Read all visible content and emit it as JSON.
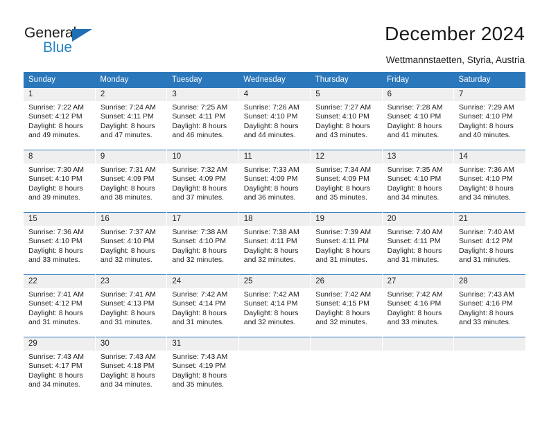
{
  "logo": {
    "text_primary": "General",
    "text_secondary": "Blue",
    "triangle_icon": "triangle-icon",
    "color_primary": "#1a1a1a",
    "color_secondary": "#2484c6"
  },
  "header": {
    "title": "December 2024",
    "subtitle": "Wettmannstaetten, Styria, Austria"
  },
  "theme": {
    "header_bg": "#2b77bb",
    "daynum_bg": "#efefef",
    "text": "#222222"
  },
  "calendar": {
    "weekday_headers": [
      "Sunday",
      "Monday",
      "Tuesday",
      "Wednesday",
      "Thursday",
      "Friday",
      "Saturday"
    ],
    "weeks": [
      [
        {
          "day": "1",
          "sunrise": "Sunrise: 7:22 AM",
          "sunset": "Sunset: 4:12 PM",
          "daylight_line1": "Daylight: 8 hours",
          "daylight_line2": "and 49 minutes."
        },
        {
          "day": "2",
          "sunrise": "Sunrise: 7:24 AM",
          "sunset": "Sunset: 4:11 PM",
          "daylight_line1": "Daylight: 8 hours",
          "daylight_line2": "and 47 minutes."
        },
        {
          "day": "3",
          "sunrise": "Sunrise: 7:25 AM",
          "sunset": "Sunset: 4:11 PM",
          "daylight_line1": "Daylight: 8 hours",
          "daylight_line2": "and 46 minutes."
        },
        {
          "day": "4",
          "sunrise": "Sunrise: 7:26 AM",
          "sunset": "Sunset: 4:10 PM",
          "daylight_line1": "Daylight: 8 hours",
          "daylight_line2": "and 44 minutes."
        },
        {
          "day": "5",
          "sunrise": "Sunrise: 7:27 AM",
          "sunset": "Sunset: 4:10 PM",
          "daylight_line1": "Daylight: 8 hours",
          "daylight_line2": "and 43 minutes."
        },
        {
          "day": "6",
          "sunrise": "Sunrise: 7:28 AM",
          "sunset": "Sunset: 4:10 PM",
          "daylight_line1": "Daylight: 8 hours",
          "daylight_line2": "and 41 minutes."
        },
        {
          "day": "7",
          "sunrise": "Sunrise: 7:29 AM",
          "sunset": "Sunset: 4:10 PM",
          "daylight_line1": "Daylight: 8 hours",
          "daylight_line2": "and 40 minutes."
        }
      ],
      [
        {
          "day": "8",
          "sunrise": "Sunrise: 7:30 AM",
          "sunset": "Sunset: 4:10 PM",
          "daylight_line1": "Daylight: 8 hours",
          "daylight_line2": "and 39 minutes."
        },
        {
          "day": "9",
          "sunrise": "Sunrise: 7:31 AM",
          "sunset": "Sunset: 4:09 PM",
          "daylight_line1": "Daylight: 8 hours",
          "daylight_line2": "and 38 minutes."
        },
        {
          "day": "10",
          "sunrise": "Sunrise: 7:32 AM",
          "sunset": "Sunset: 4:09 PM",
          "daylight_line1": "Daylight: 8 hours",
          "daylight_line2": "and 37 minutes."
        },
        {
          "day": "11",
          "sunrise": "Sunrise: 7:33 AM",
          "sunset": "Sunset: 4:09 PM",
          "daylight_line1": "Daylight: 8 hours",
          "daylight_line2": "and 36 minutes."
        },
        {
          "day": "12",
          "sunrise": "Sunrise: 7:34 AM",
          "sunset": "Sunset: 4:09 PM",
          "daylight_line1": "Daylight: 8 hours",
          "daylight_line2": "and 35 minutes."
        },
        {
          "day": "13",
          "sunrise": "Sunrise: 7:35 AM",
          "sunset": "Sunset: 4:10 PM",
          "daylight_line1": "Daylight: 8 hours",
          "daylight_line2": "and 34 minutes."
        },
        {
          "day": "14",
          "sunrise": "Sunrise: 7:36 AM",
          "sunset": "Sunset: 4:10 PM",
          "daylight_line1": "Daylight: 8 hours",
          "daylight_line2": "and 34 minutes."
        }
      ],
      [
        {
          "day": "15",
          "sunrise": "Sunrise: 7:36 AM",
          "sunset": "Sunset: 4:10 PM",
          "daylight_line1": "Daylight: 8 hours",
          "daylight_line2": "and 33 minutes."
        },
        {
          "day": "16",
          "sunrise": "Sunrise: 7:37 AM",
          "sunset": "Sunset: 4:10 PM",
          "daylight_line1": "Daylight: 8 hours",
          "daylight_line2": "and 32 minutes."
        },
        {
          "day": "17",
          "sunrise": "Sunrise: 7:38 AM",
          "sunset": "Sunset: 4:10 PM",
          "daylight_line1": "Daylight: 8 hours",
          "daylight_line2": "and 32 minutes."
        },
        {
          "day": "18",
          "sunrise": "Sunrise: 7:38 AM",
          "sunset": "Sunset: 4:11 PM",
          "daylight_line1": "Daylight: 8 hours",
          "daylight_line2": "and 32 minutes."
        },
        {
          "day": "19",
          "sunrise": "Sunrise: 7:39 AM",
          "sunset": "Sunset: 4:11 PM",
          "daylight_line1": "Daylight: 8 hours",
          "daylight_line2": "and 31 minutes."
        },
        {
          "day": "20",
          "sunrise": "Sunrise: 7:40 AM",
          "sunset": "Sunset: 4:11 PM",
          "daylight_line1": "Daylight: 8 hours",
          "daylight_line2": "and 31 minutes."
        },
        {
          "day": "21",
          "sunrise": "Sunrise: 7:40 AM",
          "sunset": "Sunset: 4:12 PM",
          "daylight_line1": "Daylight: 8 hours",
          "daylight_line2": "and 31 minutes."
        }
      ],
      [
        {
          "day": "22",
          "sunrise": "Sunrise: 7:41 AM",
          "sunset": "Sunset: 4:12 PM",
          "daylight_line1": "Daylight: 8 hours",
          "daylight_line2": "and 31 minutes."
        },
        {
          "day": "23",
          "sunrise": "Sunrise: 7:41 AM",
          "sunset": "Sunset: 4:13 PM",
          "daylight_line1": "Daylight: 8 hours",
          "daylight_line2": "and 31 minutes."
        },
        {
          "day": "24",
          "sunrise": "Sunrise: 7:42 AM",
          "sunset": "Sunset: 4:14 PM",
          "daylight_line1": "Daylight: 8 hours",
          "daylight_line2": "and 31 minutes."
        },
        {
          "day": "25",
          "sunrise": "Sunrise: 7:42 AM",
          "sunset": "Sunset: 4:14 PM",
          "daylight_line1": "Daylight: 8 hours",
          "daylight_line2": "and 32 minutes."
        },
        {
          "day": "26",
          "sunrise": "Sunrise: 7:42 AM",
          "sunset": "Sunset: 4:15 PM",
          "daylight_line1": "Daylight: 8 hours",
          "daylight_line2": "and 32 minutes."
        },
        {
          "day": "27",
          "sunrise": "Sunrise: 7:42 AM",
          "sunset": "Sunset: 4:16 PM",
          "daylight_line1": "Daylight: 8 hours",
          "daylight_line2": "and 33 minutes."
        },
        {
          "day": "28",
          "sunrise": "Sunrise: 7:43 AM",
          "sunset": "Sunset: 4:16 PM",
          "daylight_line1": "Daylight: 8 hours",
          "daylight_line2": "and 33 minutes."
        }
      ],
      [
        {
          "day": "29",
          "sunrise": "Sunrise: 7:43 AM",
          "sunset": "Sunset: 4:17 PM",
          "daylight_line1": "Daylight: 8 hours",
          "daylight_line2": "and 34 minutes."
        },
        {
          "day": "30",
          "sunrise": "Sunrise: 7:43 AM",
          "sunset": "Sunset: 4:18 PM",
          "daylight_line1": "Daylight: 8 hours",
          "daylight_line2": "and 34 minutes."
        },
        {
          "day": "31",
          "sunrise": "Sunrise: 7:43 AM",
          "sunset": "Sunset: 4:19 PM",
          "daylight_line1": "Daylight: 8 hours",
          "daylight_line2": "and 35 minutes."
        },
        {
          "day": "",
          "sunrise": "",
          "sunset": "",
          "daylight_line1": "",
          "daylight_line2": ""
        },
        {
          "day": "",
          "sunrise": "",
          "sunset": "",
          "daylight_line1": "",
          "daylight_line2": ""
        },
        {
          "day": "",
          "sunrise": "",
          "sunset": "",
          "daylight_line1": "",
          "daylight_line2": ""
        },
        {
          "day": "",
          "sunrise": "",
          "sunset": "",
          "daylight_line1": "",
          "daylight_line2": ""
        }
      ]
    ]
  }
}
